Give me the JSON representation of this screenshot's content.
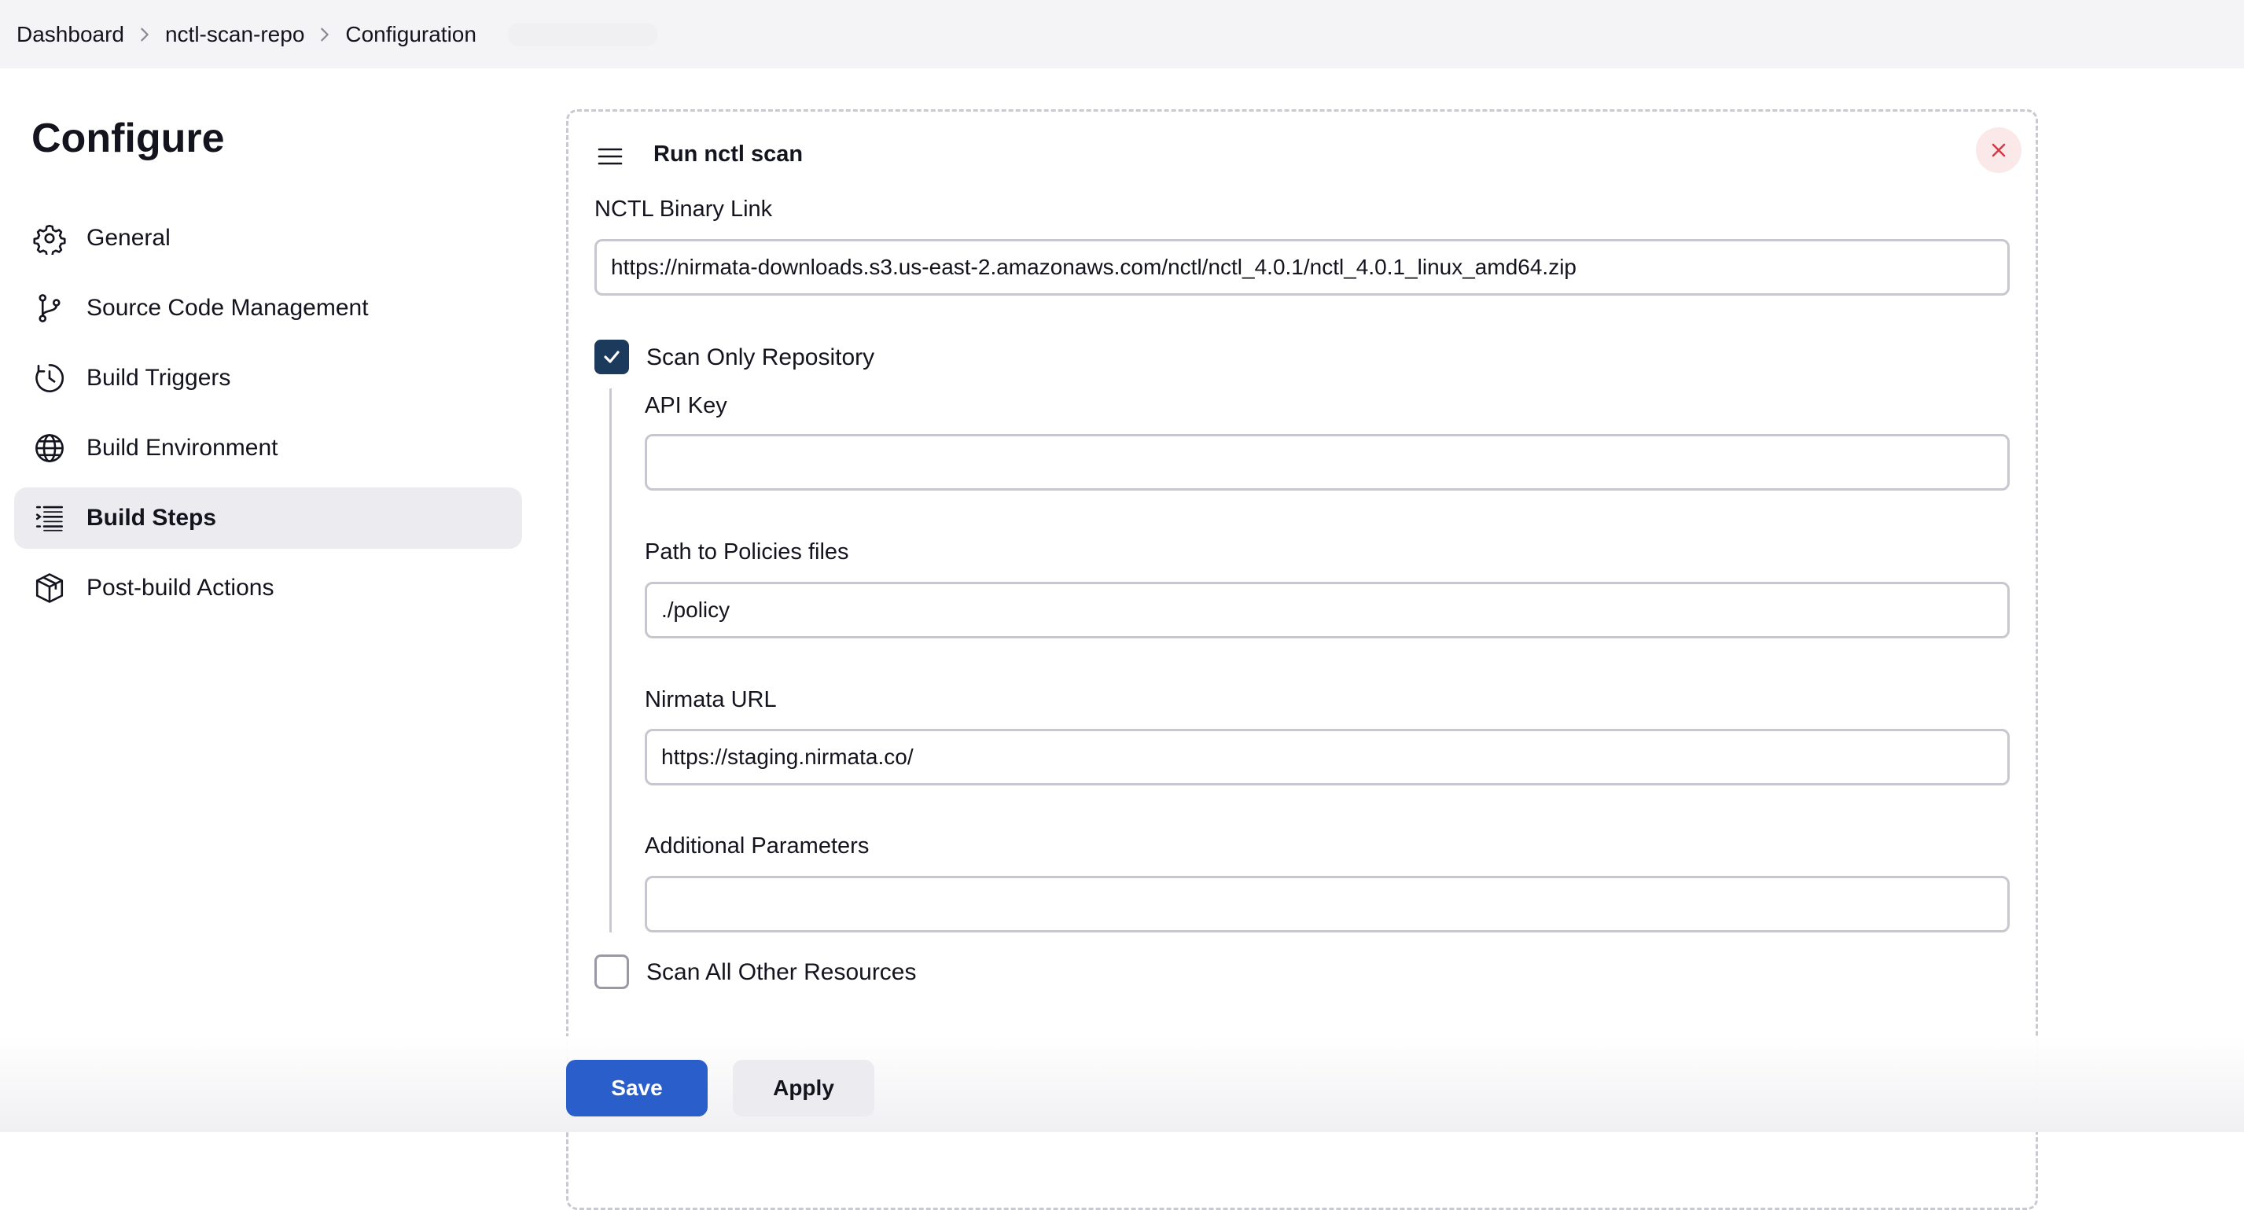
{
  "breadcrumb": {
    "items": [
      "Dashboard",
      "nctl-scan-repo",
      "Configuration"
    ]
  },
  "page": {
    "title": "Configure"
  },
  "sidebar": {
    "items": [
      {
        "label": "General",
        "icon": "gear-icon"
      },
      {
        "label": "Source Code Management",
        "icon": "branch-icon"
      },
      {
        "label": "Build Triggers",
        "icon": "clock-icon"
      },
      {
        "label": "Build Environment",
        "icon": "globe-icon"
      },
      {
        "label": "Build Steps",
        "icon": "list-icon",
        "active": true
      },
      {
        "label": "Post-build Actions",
        "icon": "package-icon"
      }
    ]
  },
  "build_step": {
    "title": "Run nctl scan",
    "nctl_binary": {
      "label": "NCTL Binary Link",
      "value": "https://nirmata-downloads.s3.us-east-2.amazonaws.com/nctl/nctl_4.0.1/nctl_4.0.1_linux_amd64.zip"
    },
    "scan_only_repository": {
      "label": "Scan Only Repository",
      "checked": true
    },
    "api_key": {
      "label": "API Key",
      "value": ""
    },
    "policies_path": {
      "label": "Path to Policies files",
      "value": "./policy"
    },
    "nirmata_url": {
      "label": "Nirmata URL",
      "value": "https://staging.nirmata.co/"
    },
    "additional_params": {
      "label": "Additional Parameters",
      "value": ""
    },
    "scan_all_other": {
      "label": "Scan All Other Resources",
      "checked": false
    }
  },
  "footer": {
    "save_label": "Save",
    "apply_label": "Apply"
  },
  "colors": {
    "primary": "#2a5fcb",
    "checkbox": "#1b3a5c",
    "close_bg": "#fbe9ea",
    "close_icon": "#d33a45"
  }
}
